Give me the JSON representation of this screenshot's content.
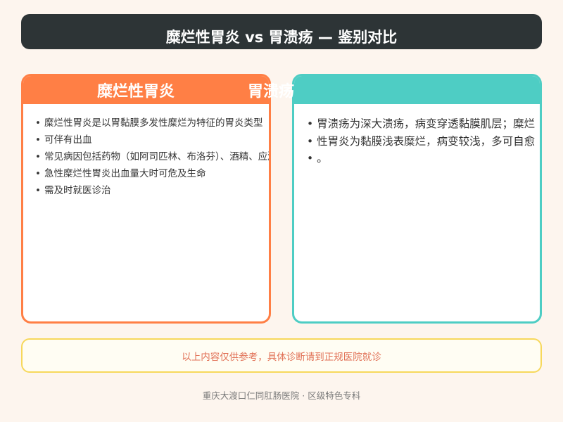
{
  "page": {
    "background": "#fdf5ee"
  },
  "header": {
    "title": "糜烂性胃炎 vs 胃溃疡 — 鉴别对比",
    "background": "#2d3436"
  },
  "cards": [
    {
      "title": "糜烂性胃炎",
      "accent": "#ff7f45",
      "items": [
        "糜烂性胃炎是以胃黏膜多发性糜烂为特征的胃炎类型",
        "可伴有出血",
        "常见病因包括药物（如阿司匹林、布洛芬）、酒精、应激",
        "急性糜烂性胃炎出血量大时可危及生命",
        "需及时就医诊治"
      ]
    },
    {
      "title": "胃溃疡",
      "accent": "#4ecdc4",
      "items": [
        "胃溃疡为深大溃疡，病变穿透黏膜肌层；糜烂",
        "性胃炎为黏膜浅表糜烂，病变较浅，多可自愈",
        "。"
      ]
    }
  ],
  "disclaimer": {
    "text": "以上内容仅供参考，具体诊断请到正规医院就诊",
    "text_color": "#e17055",
    "border_color": "#f7d85b",
    "background": "#fffdf3"
  },
  "footer": {
    "text": "重庆大渡口仁同肛肠医院 · 区级特色专科",
    "color": "#7a7a7a"
  }
}
